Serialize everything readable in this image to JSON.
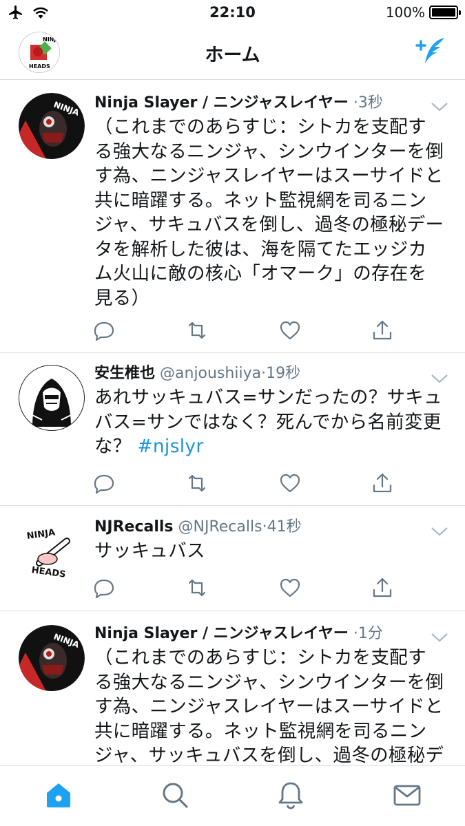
{
  "status_bar": {
    "time": "22:10",
    "battery": "100%",
    "battery_level": 1.0,
    "icons": [
      "airplane-icon",
      "wifi-icon",
      "battery-icon"
    ]
  },
  "header": {
    "title": "ホーム",
    "avatar_text": [
      "NINJA",
      "HEADS"
    ],
    "compose_icon": "compose-tweet-icon"
  },
  "tweets": [
    {
      "name": "Ninja Slayer / ニンジャスレイヤー",
      "handle": "",
      "dot": "·",
      "time": "3秒",
      "lines": [
        "（これまでのあらすじ：シトカを支配す",
        "る強大なるニンジャ、シンウインターを倒",
        "す為、ニンジャスレイヤーはスーサイドと",
        "共に暗躍する。ネット監視網を司るニン",
        "ジャ、サキュバスを倒し、過冬の極秘デー",
        "タを解析した彼は、海を隔てたエッジカ",
        "ム火山に敵の核心「オマーク」の存在を",
        "見る）"
      ],
      "avatar_text": "NINJA SLAYER"
    },
    {
      "name": "安生椎也",
      "handle": "@anjoushiiya",
      "dot": "·",
      "time": "19秒",
      "lines": [
        "あれサッキュバス=サンだったの？サキュ",
        "バス=サンではなく？死んでから名前変更"
      ],
      "last_line": "な？ ",
      "hashtag": "#njslyr"
    },
    {
      "name": "NJRecalls",
      "handle": "@NJRecalls",
      "dot": "·",
      "time": "41秒",
      "lines": [
        "サッキュバス"
      ],
      "avatar_text": [
        "NINJA",
        "HEADS"
      ]
    },
    {
      "name": "Ninja Slayer / ニンジャスレイヤー",
      "handle": "",
      "dot": "·",
      "time": "1分",
      "lines": [
        "（これまでのあらすじ：シトカを支配す",
        "る強大なるニンジャ、シンウインターを倒",
        "す為、ニンジャスレイヤーはスーサイドと",
        "共に暗躍する。ネット監視網を司るニン",
        "ジャ、サッキュバスを倒し、過冬の極秘デ"
      ],
      "avatar_text": "NINJA SLAYER"
    }
  ],
  "tweet_actions": [
    "reply-icon",
    "retweet-icon",
    "like-icon",
    "share-icon"
  ],
  "tabbar": {
    "tabs": [
      "home-icon",
      "search-icon",
      "notifications-icon",
      "messages-icon"
    ],
    "active": "home-icon"
  },
  "colors": {
    "accent": "#1da1f2",
    "link": "#1b95e0",
    "secondary_text": "#657786",
    "icon_gray": "#657786",
    "divider": "#d8dee2"
  }
}
